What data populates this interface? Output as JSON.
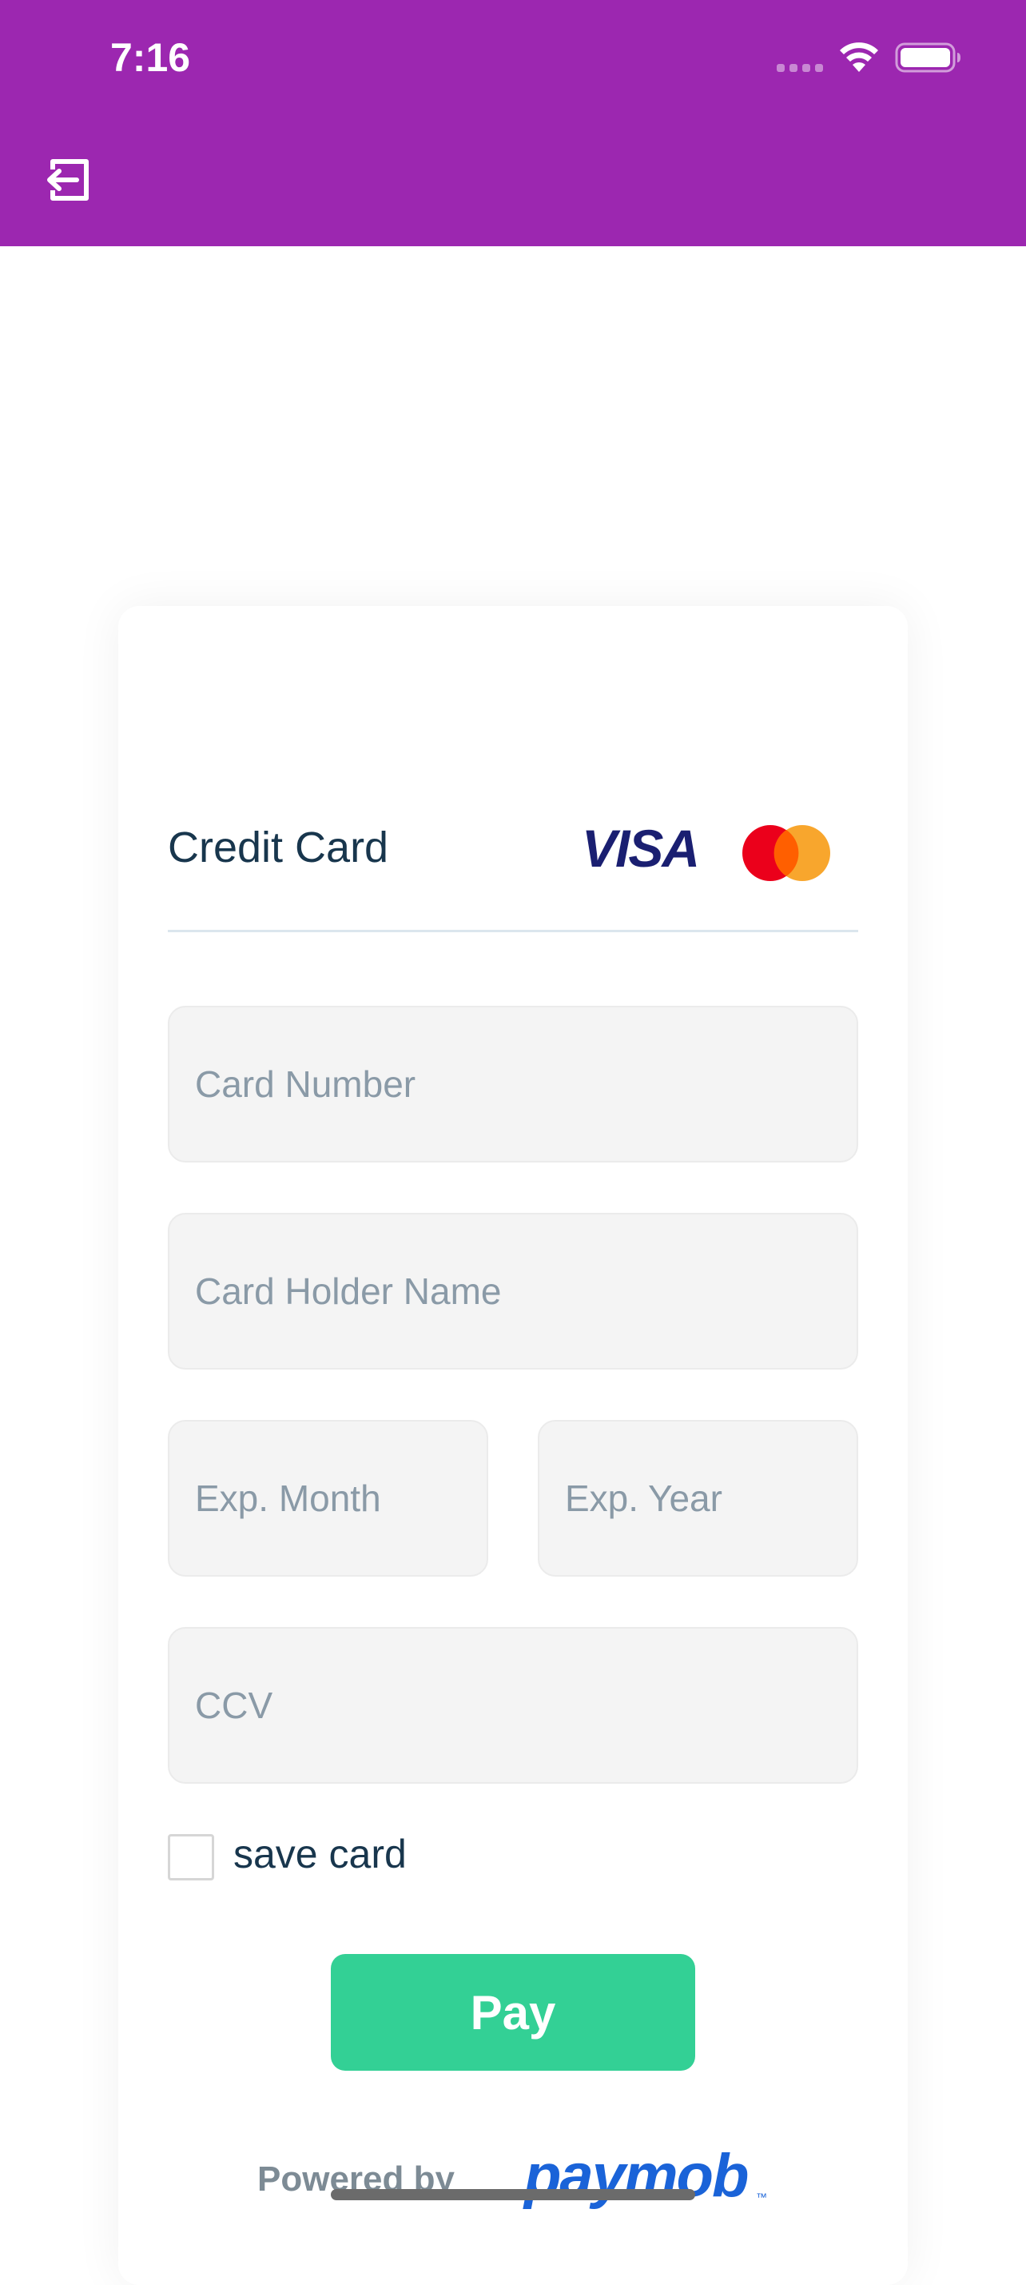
{
  "status_bar": {
    "time": "7:16",
    "icons": [
      "signal-dots-icon",
      "wifi-icon",
      "battery-icon"
    ]
  },
  "app_bar": {
    "background_color": "#9C27B0",
    "exit_icon": "exit-icon"
  },
  "payment_form": {
    "section_title": "Credit Card",
    "card_brands": [
      "visa-logo",
      "mastercard-logo"
    ],
    "fields": {
      "card_number": {
        "placeholder": "Card Number",
        "value": ""
      },
      "card_holder": {
        "placeholder": "Card Holder Name",
        "value": ""
      },
      "exp_month": {
        "placeholder": "Exp. Month",
        "value": ""
      },
      "exp_year": {
        "placeholder": "Exp. Year",
        "value": ""
      },
      "ccv": {
        "placeholder": "CCV",
        "value": ""
      }
    },
    "save_card": {
      "label": "save card",
      "checked": false
    },
    "pay_button": {
      "label": "Pay",
      "color": "#33d095"
    }
  },
  "footer": {
    "powered_by": "Powered by",
    "brand": "paymob",
    "brand_color": "#1a63d8"
  }
}
